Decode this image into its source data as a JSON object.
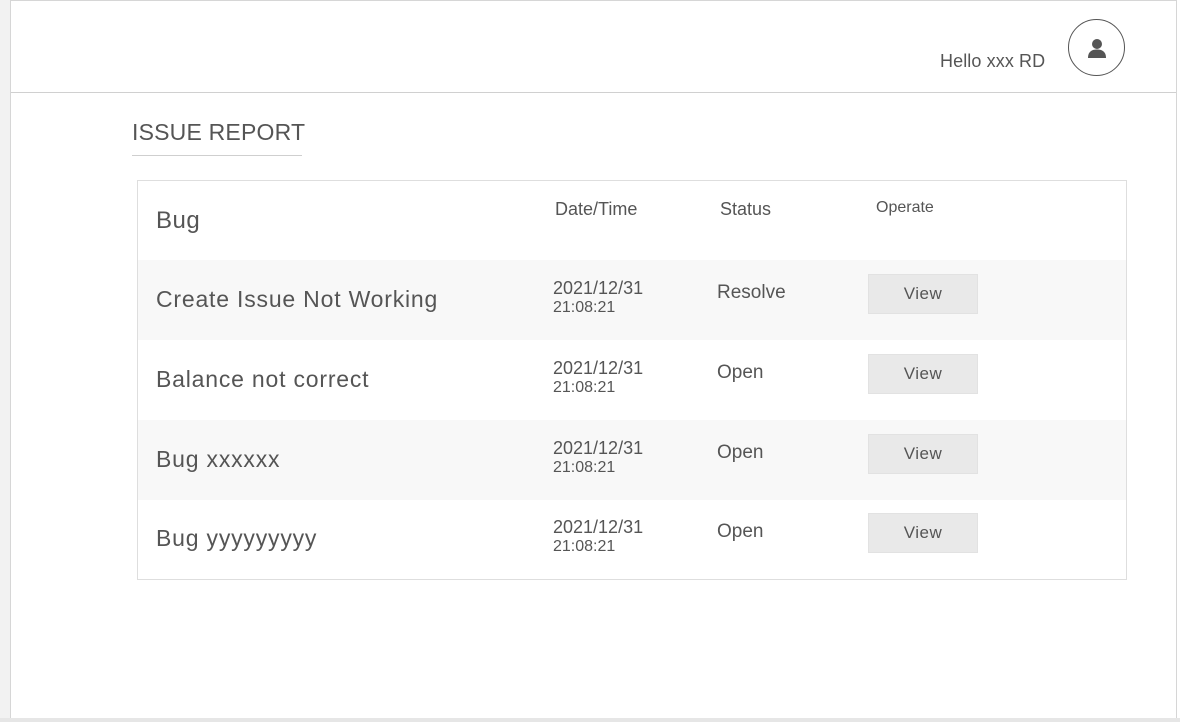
{
  "header": {
    "greeting": "Hello xxx RD",
    "avatar_icon": "user-icon"
  },
  "page": {
    "title": "ISSUE REPORT"
  },
  "table": {
    "columns": {
      "bug": "Bug",
      "date_time": "Date/Time",
      "status": "Status",
      "operate": "Operate"
    },
    "rows": [
      {
        "title": "Create Issue Not Working",
        "date": "2021/12/31",
        "time": "21:08:21",
        "status": "Resolve",
        "action": "View"
      },
      {
        "title": "Balance not correct",
        "date": "2021/12/31",
        "time": "21:08:21",
        "status": "Open",
        "action": "View"
      },
      {
        "title": "Bug xxxxxx",
        "date": "2021/12/31",
        "time": "21:08:21",
        "status": "Open",
        "action": "View"
      },
      {
        "title": "Bug yyyyyyyyy",
        "date": "2021/12/31",
        "time": "21:08:21",
        "status": "Open",
        "action": "View"
      }
    ]
  }
}
